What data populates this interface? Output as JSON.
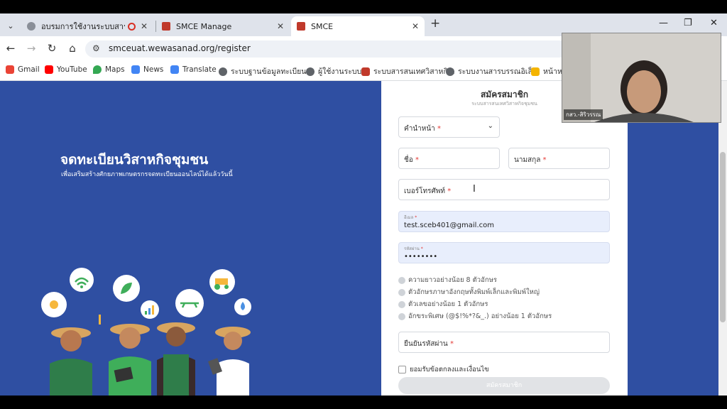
{
  "browser": {
    "tabs": [
      {
        "title": "อบรมการใช้งานระบบสารสนเทศ…",
        "active": false
      },
      {
        "title": "SMCE Manage",
        "active": false
      },
      {
        "title": "SMCE",
        "active": true
      }
    ],
    "tab_close": "✕",
    "new_tab": "+",
    "window_controls": {
      "minimize": "—",
      "restore": "❐",
      "close": "✕"
    },
    "nav": {
      "back": "←",
      "forward": "→",
      "reload": "↻",
      "home": "⌂"
    },
    "url": "smceuat.wewasanad.org/register",
    "site_icon": "⚙",
    "bookmarks": [
      {
        "label": "Gmail",
        "icon": "gmail-icon",
        "color": "#ea4335"
      },
      {
        "label": "YouTube",
        "icon": "youtube-icon",
        "color": "#ff0000"
      },
      {
        "label": "Maps",
        "icon": "maps-icon",
        "color": "#34a853"
      },
      {
        "label": "News",
        "icon": "news-icon",
        "color": "#4285f4"
      },
      {
        "label": "Translate",
        "icon": "translate-icon",
        "color": "#4285f4"
      },
      {
        "label": "ระบบฐานข้อมูลทะเบียน...",
        "icon": "globe-icon",
        "color": "#5f6368"
      },
      {
        "label": "ผู้ใช้งานระบบ",
        "icon": "globe-icon",
        "color": "#5f6368"
      },
      {
        "label": "ระบบสารสนเทศวิสาหกิ...",
        "icon": "smce-icon",
        "color": "#c0392b"
      },
      {
        "label": "ระบบงานสารบรรณอิเล็...",
        "icon": "globe-icon",
        "color": "#5f6368"
      },
      {
        "label": "หน้าหล",
        "icon": "smce-icon",
        "color": "#f4b400"
      }
    ]
  },
  "hero": {
    "title": "จดทะเบียนวิสาหกิจชุมชน",
    "subtitle": "เพื่อเสริมสร้างศักยภาพเกษตรกรจดทะเบียนออนไลน์ได้แล้ววันนี้"
  },
  "form": {
    "title": "สมัครสมาชิก",
    "subtitle": "ระบบสารสนเทศวิสาหกิจชุมชน",
    "prefix_label": "คำนำหน้า",
    "firstname_label": "ชื่อ",
    "lastname_label": "นามสกุล",
    "phone_label": "เบอร์โทรศัพท์",
    "email_label": "อีเมล",
    "email_value": "test.sceb401@gmail.com",
    "password_label": "รหัสผ่าน",
    "password_value": "••••••••",
    "required_mark": "*",
    "rules": [
      "ความยาวอย่างน้อย 8 ตัวอักษร",
      "ตัวอักษรภาษาอังกฤษทั้งพิมพ์เล็กและพิมพ์ใหญ่",
      "ตัวเลขอย่างน้อย 1 ตัวอักษร",
      "อักขระพิเศษ (@$!%*?&_.) อย่างน้อย 1 ตัวอักษร"
    ],
    "confirm_label": "ยืนยันรหัสผ่าน",
    "terms_label": "ยอมรับข้อตกลงและเงื่อนไข",
    "submit_label": "สมัครสมาชิก"
  },
  "video": {
    "name": "กสว.-สิริวรรณ"
  },
  "colors": {
    "hero_bg": "#2f4fa2",
    "required": "#e53935",
    "filled_field": "#e8eefc"
  }
}
